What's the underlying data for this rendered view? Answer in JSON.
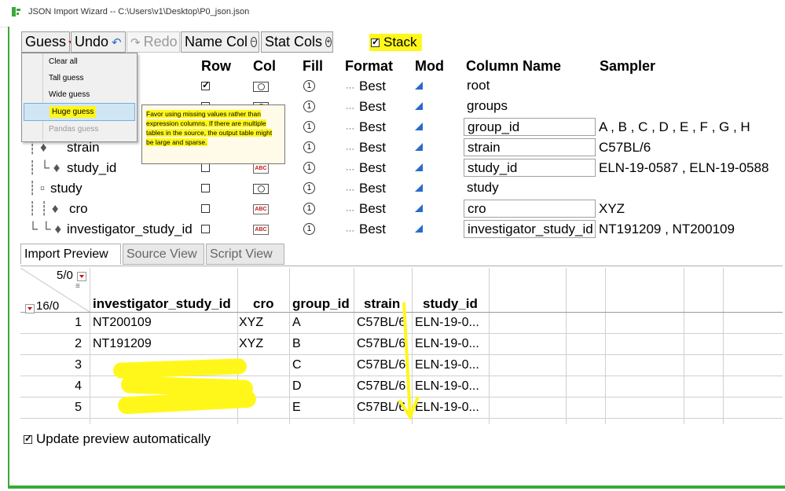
{
  "window": {
    "title": "JSON Import Wizard -- C:\\Users\\v1\\Desktop\\P0_json.json"
  },
  "toolbar": {
    "guess": "Guess",
    "undo": "Undo",
    "redo": "Redo",
    "name_col": "Name Col",
    "stat_cols": "Stat Cols",
    "stack": "Stack",
    "stack_checked": true
  },
  "guess_menu": {
    "items": [
      {
        "label": "Clear all",
        "state": "normal"
      },
      {
        "label": "Tall guess",
        "state": "normal"
      },
      {
        "label": "Wide guess",
        "state": "normal"
      },
      {
        "label": "Huge guess",
        "state": "selected"
      },
      {
        "label": "Pandas guess",
        "state": "disabled"
      }
    ]
  },
  "tooltip": {
    "text": "Favor using missing values rather than expression columns. If there are multiple tables in the source, the output table might be large and sparse."
  },
  "structure_table": {
    "headers": {
      "row": "Row",
      "col": "Col",
      "fill": "Fill",
      "format": "Format",
      "mod": "Mod",
      "column_name": "Column Name",
      "sampler": "Sampler"
    },
    "rows": [
      {
        "tree": "",
        "name": "",
        "row_checked": true,
        "col_type": "container",
        "format": "Best",
        "column_name": "root",
        "boxed": false,
        "sampler": ""
      },
      {
        "tree": "",
        "name": "",
        "row_checked": false,
        "col_type": "container",
        "format": "Best",
        "column_name": "groups",
        "boxed": false,
        "sampler": ""
      },
      {
        "tree": "",
        "name": "",
        "row_checked": false,
        "col_type": "container",
        "format": "Best",
        "column_name": "group_id",
        "boxed": true,
        "sampler": "A , B , C , D , E , F , G , H"
      },
      {
        "tree": "┊ ♦",
        "name": "strain",
        "row_checked": false,
        "col_type": "container",
        "format": "Best",
        "column_name": "strain",
        "boxed": true,
        "sampler": "C57BL/6"
      },
      {
        "tree": "┊ └ ♦",
        "name": "study_id",
        "row_checked": false,
        "col_type": "ABC",
        "format": "Best",
        "column_name": "study_id",
        "boxed": true,
        "sampler": "ELN-19-0587 , ELN-19-0588"
      },
      {
        "tree": "┊ ▫",
        "name": "study",
        "row_checked": false,
        "col_type": "container",
        "format": "Best",
        "column_name": "study",
        "boxed": false,
        "sampler": ""
      },
      {
        "tree": "┊ ┊ ♦",
        "name": "cro",
        "row_checked": false,
        "col_type": "ABC",
        "format": "Best",
        "column_name": "cro",
        "boxed": true,
        "sampler": "XYZ"
      },
      {
        "tree": "└ └ ♦",
        "name": "investigator_study_id",
        "row_checked": false,
        "col_type": "ABC",
        "format": "Best",
        "column_name": "investigator_study_id",
        "boxed": true,
        "sampler": "NT191209 , NT200109"
      }
    ]
  },
  "preview_tabs": [
    "Import Preview",
    "Source View",
    "Script View"
  ],
  "preview": {
    "cols_count": "5/0",
    "rows_count": "16/0",
    "headers": [
      "investigator_study_id",
      "cro",
      "group_id",
      "strain",
      "study_id"
    ],
    "rows": [
      {
        "n": "1",
        "cells": [
          "NT200109",
          "XYZ",
          "A",
          "C57BL/6",
          "ELN-19-0..."
        ]
      },
      {
        "n": "2",
        "cells": [
          "NT191209",
          "XYZ",
          "B",
          "C57BL/6",
          "ELN-19-0..."
        ]
      },
      {
        "n": "3",
        "cells": [
          "",
          "",
          "C",
          "C57BL/6",
          "ELN-19-0..."
        ]
      },
      {
        "n": "4",
        "cells": [
          "",
          "",
          "D",
          "C57BL/6",
          "ELN-19-0..."
        ]
      },
      {
        "n": "5",
        "cells": [
          "",
          "",
          "E",
          "C57BL/6",
          "ELN-19-0..."
        ]
      }
    ]
  },
  "update_preview": {
    "label": "Update preview automatically",
    "checked": true
  },
  "colors": {
    "accent_green": "#3aa93a",
    "highlight_yellow": "#fff71a",
    "mod_blue": "#2a6acd",
    "dropdown_red": "#cc1111"
  }
}
